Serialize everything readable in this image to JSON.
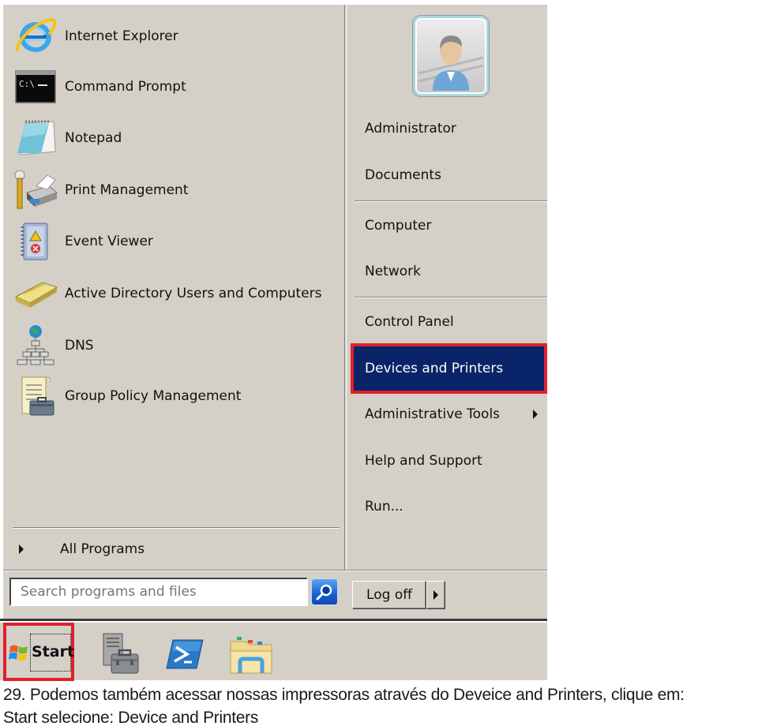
{
  "start_menu": {
    "pinned_programs": [
      {
        "label": "Internet Explorer",
        "icon": "internet-explorer-icon"
      },
      {
        "label": "Command Prompt",
        "icon": "command-prompt-icon"
      },
      {
        "label": "Notepad",
        "icon": "notepad-icon"
      },
      {
        "label": "Print Management",
        "icon": "print-management-icon"
      },
      {
        "label": "Event Viewer",
        "icon": "event-viewer-icon"
      },
      {
        "label": "Active Directory Users and Computers",
        "icon": "active-directory-icon"
      },
      {
        "label": "DNS",
        "icon": "dns-icon"
      },
      {
        "label": "Group Policy Management",
        "icon": "group-policy-icon"
      }
    ],
    "all_programs_label": "All Programs",
    "search": {
      "placeholder": "Search programs and files",
      "value": ""
    },
    "right_items": [
      {
        "label": "Administrator"
      },
      {
        "label": "Documents"
      },
      {
        "label": "Computer"
      },
      {
        "label": "Network"
      },
      {
        "label": "Control Panel"
      },
      {
        "label": "Devices and Printers",
        "highlighted": true
      },
      {
        "label": "Administrative Tools",
        "has_submenu": true
      },
      {
        "label": "Help and Support"
      },
      {
        "label": "Run..."
      }
    ],
    "logoff_label": "Log off"
  },
  "taskbar": {
    "start_label": "Start",
    "pinned": [
      "server-manager-icon",
      "powershell-icon",
      "windows-explorer-icon"
    ]
  },
  "caption": {
    "line1": "29. Podemos também acessar nossas impressoras através do Deveice and Printers, clique em:",
    "line2": "Start selecione: Device and Printers"
  },
  "colors": {
    "menu_bg": "#d4d0c8",
    "highlight_bg": "#0a246a",
    "annotation_red": "#e0202c"
  }
}
